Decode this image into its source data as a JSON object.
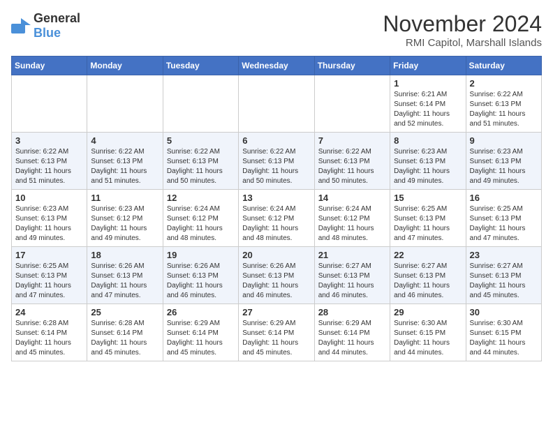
{
  "logo": {
    "text_general": "General",
    "text_blue": "Blue"
  },
  "header": {
    "month": "November 2024",
    "location": "RMI Capitol, Marshall Islands"
  },
  "days_of_week": [
    "Sunday",
    "Monday",
    "Tuesday",
    "Wednesday",
    "Thursday",
    "Friday",
    "Saturday"
  ],
  "weeks": [
    [
      {
        "day": "",
        "info": ""
      },
      {
        "day": "",
        "info": ""
      },
      {
        "day": "",
        "info": ""
      },
      {
        "day": "",
        "info": ""
      },
      {
        "day": "",
        "info": ""
      },
      {
        "day": "1",
        "info": "Sunrise: 6:21 AM\nSunset: 6:14 PM\nDaylight: 11 hours and 52 minutes."
      },
      {
        "day": "2",
        "info": "Sunrise: 6:22 AM\nSunset: 6:13 PM\nDaylight: 11 hours and 51 minutes."
      }
    ],
    [
      {
        "day": "3",
        "info": "Sunrise: 6:22 AM\nSunset: 6:13 PM\nDaylight: 11 hours and 51 minutes."
      },
      {
        "day": "4",
        "info": "Sunrise: 6:22 AM\nSunset: 6:13 PM\nDaylight: 11 hours and 51 minutes."
      },
      {
        "day": "5",
        "info": "Sunrise: 6:22 AM\nSunset: 6:13 PM\nDaylight: 11 hours and 50 minutes."
      },
      {
        "day": "6",
        "info": "Sunrise: 6:22 AM\nSunset: 6:13 PM\nDaylight: 11 hours and 50 minutes."
      },
      {
        "day": "7",
        "info": "Sunrise: 6:22 AM\nSunset: 6:13 PM\nDaylight: 11 hours and 50 minutes."
      },
      {
        "day": "8",
        "info": "Sunrise: 6:23 AM\nSunset: 6:13 PM\nDaylight: 11 hours and 49 minutes."
      },
      {
        "day": "9",
        "info": "Sunrise: 6:23 AM\nSunset: 6:13 PM\nDaylight: 11 hours and 49 minutes."
      }
    ],
    [
      {
        "day": "10",
        "info": "Sunrise: 6:23 AM\nSunset: 6:13 PM\nDaylight: 11 hours and 49 minutes."
      },
      {
        "day": "11",
        "info": "Sunrise: 6:23 AM\nSunset: 6:12 PM\nDaylight: 11 hours and 49 minutes."
      },
      {
        "day": "12",
        "info": "Sunrise: 6:24 AM\nSunset: 6:12 PM\nDaylight: 11 hours and 48 minutes."
      },
      {
        "day": "13",
        "info": "Sunrise: 6:24 AM\nSunset: 6:12 PM\nDaylight: 11 hours and 48 minutes."
      },
      {
        "day": "14",
        "info": "Sunrise: 6:24 AM\nSunset: 6:12 PM\nDaylight: 11 hours and 48 minutes."
      },
      {
        "day": "15",
        "info": "Sunrise: 6:25 AM\nSunset: 6:13 PM\nDaylight: 11 hours and 47 minutes."
      },
      {
        "day": "16",
        "info": "Sunrise: 6:25 AM\nSunset: 6:13 PM\nDaylight: 11 hours and 47 minutes."
      }
    ],
    [
      {
        "day": "17",
        "info": "Sunrise: 6:25 AM\nSunset: 6:13 PM\nDaylight: 11 hours and 47 minutes."
      },
      {
        "day": "18",
        "info": "Sunrise: 6:26 AM\nSunset: 6:13 PM\nDaylight: 11 hours and 47 minutes."
      },
      {
        "day": "19",
        "info": "Sunrise: 6:26 AM\nSunset: 6:13 PM\nDaylight: 11 hours and 46 minutes."
      },
      {
        "day": "20",
        "info": "Sunrise: 6:26 AM\nSunset: 6:13 PM\nDaylight: 11 hours and 46 minutes."
      },
      {
        "day": "21",
        "info": "Sunrise: 6:27 AM\nSunset: 6:13 PM\nDaylight: 11 hours and 46 minutes."
      },
      {
        "day": "22",
        "info": "Sunrise: 6:27 AM\nSunset: 6:13 PM\nDaylight: 11 hours and 46 minutes."
      },
      {
        "day": "23",
        "info": "Sunrise: 6:27 AM\nSunset: 6:13 PM\nDaylight: 11 hours and 45 minutes."
      }
    ],
    [
      {
        "day": "24",
        "info": "Sunrise: 6:28 AM\nSunset: 6:14 PM\nDaylight: 11 hours and 45 minutes."
      },
      {
        "day": "25",
        "info": "Sunrise: 6:28 AM\nSunset: 6:14 PM\nDaylight: 11 hours and 45 minutes."
      },
      {
        "day": "26",
        "info": "Sunrise: 6:29 AM\nSunset: 6:14 PM\nDaylight: 11 hours and 45 minutes."
      },
      {
        "day": "27",
        "info": "Sunrise: 6:29 AM\nSunset: 6:14 PM\nDaylight: 11 hours and 45 minutes."
      },
      {
        "day": "28",
        "info": "Sunrise: 6:29 AM\nSunset: 6:14 PM\nDaylight: 11 hours and 44 minutes."
      },
      {
        "day": "29",
        "info": "Sunrise: 6:30 AM\nSunset: 6:15 PM\nDaylight: 11 hours and 44 minutes."
      },
      {
        "day": "30",
        "info": "Sunrise: 6:30 AM\nSunset: 6:15 PM\nDaylight: 11 hours and 44 minutes."
      }
    ]
  ]
}
